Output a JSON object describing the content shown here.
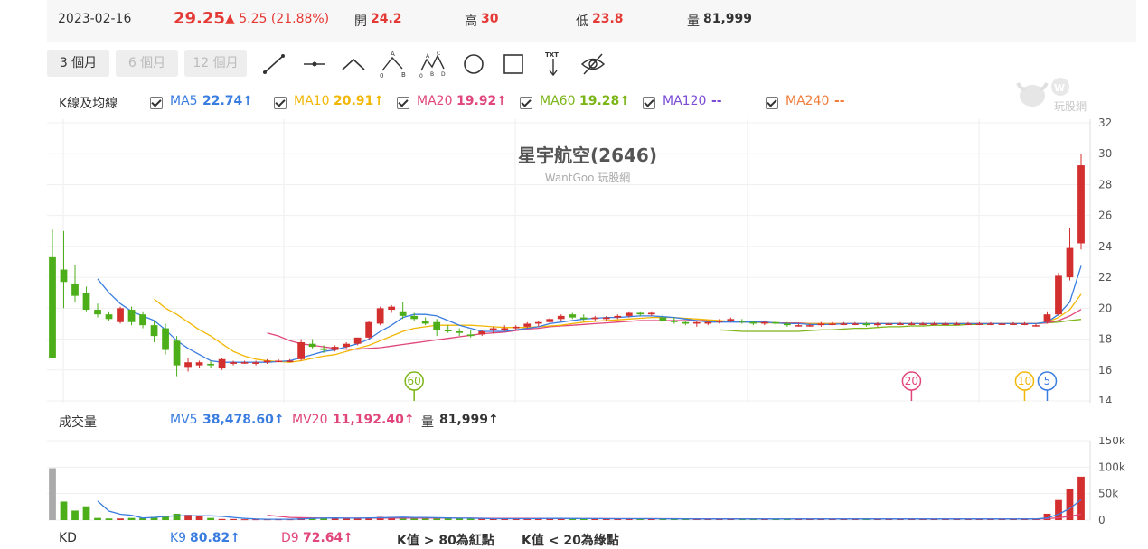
{
  "quote": {
    "date": "2023-02-16",
    "price": "29.25",
    "change": "▲ 5.25 (21.88%)",
    "open_label": "開",
    "open": "24.2",
    "high_label": "高",
    "high": "30",
    "low_label": "低",
    "low": "23.8",
    "vol_label": "量",
    "volume": "81,999"
  },
  "toolbar": {
    "periods": [
      "3 個月",
      "6 個月",
      "12 個月"
    ],
    "tools": [
      "line-tool-icon",
      "horizontal-line-icon",
      "angle-line-icon",
      "abc-wave-icon",
      "abcd-wave-icon",
      "circle-tool-icon",
      "rectangle-tool-icon",
      "text-tool-icon",
      "hide-drawings-icon"
    ]
  },
  "ma_row": {
    "title": "K線及均線",
    "items": [
      {
        "label": "MA5",
        "value": "22.74↑",
        "color": "#3a7de0"
      },
      {
        "label": "MA10",
        "value": "20.91↑",
        "color": "#f2b705"
      },
      {
        "label": "MA20",
        "value": "19.92↑",
        "color": "#e0467c"
      },
      {
        "label": "MA60",
        "value": "19.28↑",
        "color": "#7cb518"
      },
      {
        "label": "MA120",
        "value": "--",
        "color": "#7b4bd6"
      },
      {
        "label": "MA240",
        "value": "--",
        "color": "#f07d3c"
      }
    ]
  },
  "watermark": {
    "brand": "玩股網"
  },
  "chart_title": {
    "title": "星宇航空(2646)",
    "subtitle": "WantGoo 玩股網"
  },
  "volume_row": {
    "title": "成交量",
    "mv5_label": "MV5",
    "mv5_value": "38,478.60↑",
    "mv20_label": "MV20",
    "mv20_value": "11,192.40↑",
    "vol_label": "量",
    "vol_value": "81,999↑"
  },
  "kd_row": {
    "title": "KD",
    "k9_label": "K9",
    "k9_value": "80.82↑",
    "d9_label": "D9",
    "d9_value": "72.64↑",
    "note1": "K值 > 80為紅點",
    "note2": "K值 < 20為綠點"
  },
  "chart_data": [
    {
      "type": "candlestick",
      "title": "星宇航空(2646)",
      "y_ticks": [
        "32",
        "30",
        "28",
        "26",
        "24",
        "22",
        "20",
        "18",
        "16",
        "14"
      ],
      "ylim": [
        14,
        32
      ],
      "ohlc": [
        [
          23.3,
          25.1,
          17.6,
          16.8
        ],
        [
          22.5,
          25.0,
          20.0,
          21.7
        ],
        [
          21.6,
          22.8,
          20.4,
          20.8
        ],
        [
          21.0,
          21.4,
          19.8,
          19.9
        ],
        [
          19.9,
          20.3,
          19.4,
          19.6
        ],
        [
          19.6,
          19.8,
          19.2,
          19.3
        ],
        [
          19.1,
          20.1,
          19.0,
          20.0
        ],
        [
          19.9,
          20.1,
          18.9,
          19.1
        ],
        [
          19.6,
          19.8,
          18.7,
          18.9
        ],
        [
          18.9,
          19.2,
          17.8,
          18.2
        ],
        [
          18.7,
          19.0,
          17.0,
          17.3
        ],
        [
          17.9,
          18.2,
          15.6,
          16.3
        ],
        [
          16.2,
          16.8,
          15.9,
          16.5
        ],
        [
          16.3,
          16.6,
          16.1,
          16.5
        ],
        [
          16.4,
          16.6,
          16.1,
          16.3
        ],
        [
          16.1,
          16.8,
          16.0,
          16.7
        ],
        [
          16.4,
          16.6,
          16.3,
          16.5
        ],
        [
          16.5,
          16.6,
          16.4,
          16.5
        ],
        [
          16.4,
          16.6,
          16.3,
          16.5
        ],
        [
          16.5,
          16.7,
          16.4,
          16.6
        ],
        [
          16.6,
          16.7,
          16.5,
          16.6
        ],
        [
          16.6,
          16.7,
          16.5,
          16.6
        ],
        [
          16.7,
          18.0,
          16.6,
          17.8
        ],
        [
          17.7,
          18.0,
          17.4,
          17.5
        ],
        [
          17.4,
          17.6,
          17.1,
          17.3
        ],
        [
          17.3,
          17.6,
          17.2,
          17.5
        ],
        [
          17.5,
          17.8,
          17.4,
          17.7
        ],
        [
          17.7,
          18.1,
          17.6,
          18.1
        ],
        [
          18.1,
          19.2,
          18.0,
          19.1
        ],
        [
          19.0,
          20.1,
          18.9,
          20.0
        ],
        [
          19.9,
          20.2,
          19.7,
          20.1
        ],
        [
          19.8,
          20.4,
          19.3,
          19.5
        ],
        [
          19.5,
          19.7,
          19.2,
          19.3
        ],
        [
          19.2,
          19.4,
          18.9,
          19.0
        ],
        [
          19.1,
          19.3,
          18.2,
          18.6
        ],
        [
          18.6,
          18.9,
          18.4,
          18.5
        ],
        [
          18.5,
          18.7,
          18.2,
          18.4
        ],
        [
          18.3,
          18.6,
          18.1,
          18.2
        ],
        [
          18.3,
          18.6,
          18.2,
          18.5
        ],
        [
          18.6,
          18.8,
          18.4,
          18.7
        ],
        [
          18.7,
          18.9,
          18.5,
          18.7
        ],
        [
          18.7,
          18.9,
          18.6,
          18.8
        ],
        [
          18.8,
          19.1,
          18.7,
          19.0
        ],
        [
          19.0,
          19.2,
          18.8,
          19.1
        ],
        [
          19.1,
          19.4,
          19.0,
          19.3
        ],
        [
          19.3,
          19.6,
          19.2,
          19.5
        ],
        [
          19.6,
          19.7,
          19.3,
          19.4
        ],
        [
          19.4,
          19.6,
          19.2,
          19.3
        ],
        [
          19.3,
          19.5,
          19.2,
          19.4
        ],
        [
          19.3,
          19.5,
          19.2,
          19.4
        ],
        [
          19.4,
          19.6,
          19.3,
          19.5
        ],
        [
          19.5,
          19.8,
          19.4,
          19.7
        ],
        [
          19.7,
          19.8,
          19.5,
          19.6
        ],
        [
          19.6,
          19.8,
          19.5,
          19.7
        ],
        [
          19.4,
          19.6,
          19.1,
          19.2
        ],
        [
          19.2,
          19.4,
          19.0,
          19.1
        ],
        [
          19.1,
          19.2,
          18.9,
          19.0
        ],
        [
          19.0,
          19.2,
          18.8,
          19.1
        ],
        [
          19.0,
          19.2,
          18.9,
          19.1
        ],
        [
          19.1,
          19.3,
          19.0,
          19.2
        ],
        [
          19.2,
          19.4,
          19.1,
          19.3
        ],
        [
          19.2,
          19.3,
          19.0,
          19.1
        ],
        [
          19.1,
          19.2,
          18.9,
          19.0
        ],
        [
          19.0,
          19.2,
          18.9,
          19.1
        ],
        [
          19.1,
          19.2,
          18.9,
          19.0
        ],
        [
          19.0,
          19.1,
          18.8,
          18.9
        ],
        [
          18.9,
          19.0,
          18.8,
          18.9
        ],
        [
          18.9,
          19.0,
          18.8,
          18.9
        ],
        [
          18.9,
          19.1,
          18.8,
          19.0
        ],
        [
          19.0,
          19.1,
          18.9,
          19.0
        ],
        [
          19.0,
          19.1,
          18.9,
          19.0
        ],
        [
          19.0,
          19.1,
          18.9,
          19.0
        ],
        [
          19.0,
          19.1,
          18.8,
          18.9
        ],
        [
          18.9,
          19.1,
          18.8,
          19.0
        ],
        [
          19.0,
          19.1,
          18.9,
          19.0
        ],
        [
          19.0,
          19.1,
          18.9,
          19.0
        ],
        [
          19.0,
          19.1,
          18.9,
          19.0
        ],
        [
          19.0,
          19.1,
          18.9,
          19.0
        ],
        [
          19.0,
          19.1,
          18.9,
          19.0
        ],
        [
          19.0,
          19.1,
          18.9,
          19.0
        ],
        [
          19.0,
          19.1,
          18.9,
          19.0
        ],
        [
          19.0,
          19.1,
          18.9,
          19.0
        ],
        [
          19.0,
          19.1,
          18.9,
          19.0
        ],
        [
          19.0,
          19.1,
          18.9,
          19.0
        ],
        [
          19.0,
          19.1,
          18.9,
          19.0
        ],
        [
          19.0,
          19.1,
          18.9,
          19.0
        ],
        [
          19.0,
          19.1,
          18.9,
          19.0
        ],
        [
          18.9,
          19.0,
          18.8,
          18.9
        ],
        [
          19.1,
          19.8,
          19.0,
          19.6
        ],
        [
          19.6,
          22.3,
          19.5,
          22.1
        ],
        [
          22.0,
          25.2,
          21.8,
          23.9
        ],
        [
          24.2,
          30.0,
          23.8,
          29.25
        ]
      ],
      "ma5": [
        null,
        null,
        null,
        null,
        21.9,
        21.0,
        20.3,
        19.8,
        19.5,
        19.2,
        18.6,
        17.9,
        17.4,
        17.0,
        16.6,
        16.5,
        16.5,
        16.5,
        16.5,
        16.5,
        16.55,
        16.6,
        16.8,
        17.0,
        17.2,
        17.3,
        17.5,
        17.7,
        18.0,
        18.5,
        18.9,
        19.4,
        19.6,
        19.6,
        19.5,
        19.2,
        18.9,
        18.7,
        18.5,
        18.5,
        18.5,
        18.6,
        18.7,
        18.8,
        19.0,
        19.1,
        19.2,
        19.3,
        19.35,
        19.4,
        19.4,
        19.45,
        19.5,
        19.5,
        19.45,
        19.4,
        19.3,
        19.2,
        19.1,
        19.1,
        19.1,
        19.1,
        19.1,
        19.1,
        19.05,
        19.0,
        19.0,
        18.95,
        18.95,
        18.95,
        19.0,
        19.0,
        19.0,
        19.0,
        19.0,
        19.0,
        19.0,
        19.0,
        19.0,
        19.0,
        19.0,
        19.0,
        19.0,
        19.0,
        19.0,
        19.0,
        19.0,
        19.0,
        19.1,
        19.6,
        20.4,
        22.74
      ],
      "ma10": [
        null,
        null,
        null,
        null,
        null,
        null,
        null,
        null,
        null,
        20.6,
        20.0,
        19.6,
        19.1,
        18.6,
        18.2,
        17.7,
        17.2,
        16.9,
        16.7,
        16.6,
        16.55,
        16.5,
        16.6,
        16.75,
        16.9,
        17.0,
        17.2,
        17.4,
        17.6,
        17.9,
        18.2,
        18.5,
        18.7,
        18.8,
        18.9,
        18.9,
        18.9,
        18.9,
        18.85,
        18.8,
        18.75,
        18.75,
        18.75,
        18.8,
        18.85,
        18.9,
        19.0,
        19.1,
        19.15,
        19.2,
        19.25,
        19.3,
        19.35,
        19.4,
        19.4,
        19.4,
        19.35,
        19.3,
        19.25,
        19.2,
        19.15,
        19.1,
        19.1,
        19.05,
        19.05,
        19.0,
        19.0,
        19.0,
        19.0,
        19.0,
        19.0,
        19.0,
        19.0,
        19.0,
        19.0,
        19.0,
        19.0,
        19.0,
        19.0,
        19.0,
        19.0,
        19.0,
        19.0,
        19.0,
        19.0,
        19.0,
        19.0,
        19.0,
        19.1,
        19.4,
        19.9,
        20.91
      ],
      "ma20": [
        null,
        null,
        null,
        null,
        null,
        null,
        null,
        null,
        null,
        null,
        null,
        null,
        null,
        null,
        null,
        null,
        null,
        null,
        null,
        18.4,
        18.2,
        17.9,
        17.7,
        17.6,
        17.5,
        17.4,
        17.35,
        17.35,
        17.4,
        17.45,
        17.55,
        17.65,
        17.75,
        17.85,
        17.95,
        18.05,
        18.15,
        18.25,
        18.35,
        18.4,
        18.45,
        18.55,
        18.65,
        18.7,
        18.8,
        18.85,
        18.9,
        18.95,
        19.0,
        19.05,
        19.1,
        19.15,
        19.2,
        19.2,
        19.2,
        19.2,
        19.2,
        19.2,
        19.2,
        19.15,
        19.15,
        19.1,
        19.1,
        19.1,
        19.05,
        19.05,
        19.05,
        19.0,
        19.0,
        19.0,
        19.0,
        19.0,
        19.0,
        19.0,
        19.0,
        19.0,
        19.0,
        19.0,
        19.0,
        19.0,
        19.0,
        19.0,
        19.0,
        19.0,
        19.0,
        19.0,
        19.0,
        19.0,
        19.05,
        19.2,
        19.5,
        19.92
      ],
      "ma60": [
        null,
        null,
        null,
        null,
        null,
        null,
        null,
        null,
        null,
        null,
        null,
        null,
        null,
        null,
        null,
        null,
        null,
        null,
        null,
        null,
        null,
        null,
        null,
        null,
        null,
        null,
        null,
        null,
        null,
        null,
        null,
        null,
        null,
        null,
        null,
        null,
        null,
        null,
        null,
        null,
        null,
        null,
        null,
        null,
        null,
        null,
        null,
        null,
        null,
        null,
        null,
        null,
        null,
        null,
        null,
        null,
        null,
        null,
        null,
        18.6,
        18.55,
        18.5,
        18.5,
        18.5,
        18.5,
        18.5,
        18.5,
        18.55,
        18.6,
        18.6,
        18.65,
        18.7,
        18.7,
        18.75,
        18.8,
        18.8,
        18.85,
        18.85,
        18.9,
        18.9,
        18.9,
        18.95,
        18.95,
        19.0,
        19.0,
        19.0,
        19.0,
        19.0,
        19.05,
        19.1,
        19.2,
        19.28
      ],
      "markers": [
        {
          "label": "60",
          "color": "#7cb518",
          "index": 32
        },
        {
          "label": "20",
          "color": "#e0467c",
          "index": 76
        },
        {
          "label": "10",
          "color": "#f2b705",
          "index": 86
        },
        {
          "label": "5",
          "color": "#3a7de0",
          "index": 88
        }
      ]
    },
    {
      "type": "bar",
      "title": "成交量",
      "y_ticks": [
        "150k",
        "100k",
        "50k",
        "0"
      ],
      "ylim": [
        0,
        150000
      ],
      "volume": [
        98000,
        35000,
        18000,
        26000,
        4000,
        3000,
        3000,
        4000,
        4000,
        6000,
        7000,
        12000,
        10000,
        8000,
        4000,
        2000,
        2000,
        1500,
        1500,
        1500,
        1500,
        1500,
        5000,
        4000,
        3000,
        3000,
        3000,
        4000,
        5000,
        6000,
        6000,
        5000,
        4000,
        4000,
        4000,
        3000,
        3000,
        2500,
        2500,
        2500,
        2500,
        2500,
        3000,
        3000,
        3000,
        3000,
        3000,
        2500,
        2500,
        2500,
        2500,
        2500,
        2500,
        2500,
        2000,
        2000,
        2000,
        2000,
        2000,
        2000,
        2000,
        2000,
        2000,
        2000,
        2000,
        2000,
        2000,
        2000,
        2000,
        2000,
        2000,
        2000,
        2000,
        2000,
        2000,
        2000,
        2000,
        2000,
        2000,
        2000,
        2000,
        2000,
        2000,
        2000,
        2000,
        2000,
        2000,
        2000,
        12000,
        38000,
        58000,
        81999
      ],
      "mv5": [
        null,
        null,
        null,
        null,
        36000,
        17000,
        11000,
        9000,
        4000,
        5000,
        7000,
        8000,
        8000,
        8000,
        8000,
        7000,
        5000,
        3000,
        2000,
        1600,
        1500,
        1500,
        2000,
        3000,
        3500,
        4000,
        3500,
        3500,
        4000,
        4500,
        5000,
        5500,
        5000,
        5000,
        4500,
        4000,
        3500,
        3500,
        3000,
        2600,
        2500,
        2500,
        2600,
        2800,
        3000,
        3000,
        2900,
        2800,
        2700,
        2600,
        2500,
        2500,
        2500,
        2500,
        2400,
        2300,
        2200,
        2100,
        2000,
        2000,
        2000,
        2000,
        2000,
        2000,
        2000,
        2000,
        2000,
        2000,
        2000,
        2000,
        2000,
        2000,
        2000,
        2000,
        2000,
        2000,
        2000,
        2000,
        2000,
        2000,
        2000,
        2000,
        2000,
        2000,
        2000,
        2000,
        2000,
        2000,
        4000,
        11000,
        22000,
        38478.6
      ],
      "mv20": [
        null,
        null,
        null,
        null,
        null,
        null,
        null,
        null,
        null,
        null,
        null,
        null,
        null,
        null,
        null,
        null,
        null,
        null,
        null,
        9000,
        7000,
        5000,
        4500,
        4000,
        3800,
        3600,
        3500,
        3500,
        3600,
        3700,
        3800,
        3800,
        3800,
        3800,
        3800,
        3700,
        3600,
        3500,
        3400,
        3300,
        3200,
        3100,
        3000,
        3000,
        2900,
        2900,
        2800,
        2800,
        2700,
        2700,
        2600,
        2600,
        2600,
        2500,
        2500,
        2500,
        2400,
        2400,
        2300,
        2300,
        2200,
        2200,
        2200,
        2100,
        2100,
        2100,
        2100,
        2100,
        2000,
        2000,
        2000,
        2000,
        2000,
        2000,
        2000,
        2000,
        2000,
        2000,
        2000,
        2000,
        2000,
        2000,
        2000,
        2000,
        2000,
        2000,
        2000,
        2000,
        2500,
        4200,
        7000,
        11192.4
      ]
    }
  ]
}
